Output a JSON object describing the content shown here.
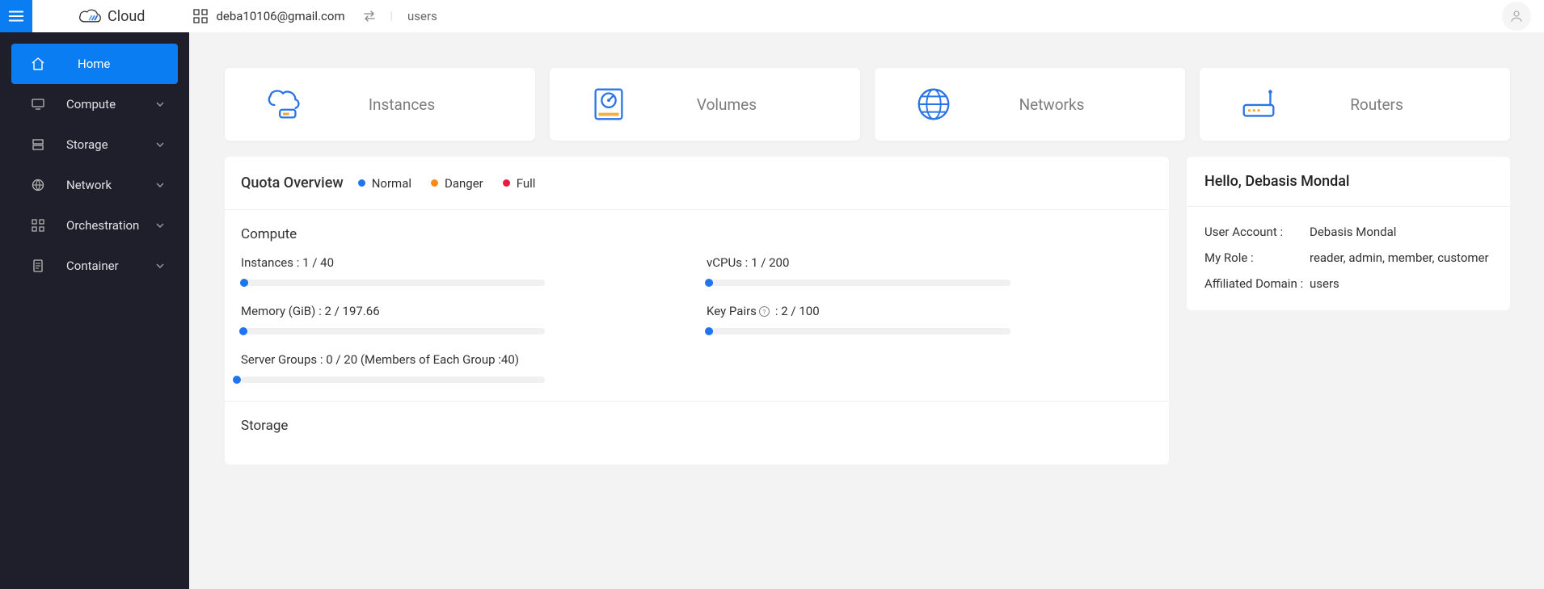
{
  "header": {
    "logo_text": "Cloud",
    "email": "deba10106@gmail.com",
    "domain": "users"
  },
  "sidebar": {
    "items": [
      {
        "label": "Home",
        "active": true,
        "icon": "home"
      },
      {
        "label": "Compute",
        "active": false,
        "icon": "compute",
        "expandable": true
      },
      {
        "label": "Storage",
        "active": false,
        "icon": "storage",
        "expandable": true
      },
      {
        "label": "Network",
        "active": false,
        "icon": "network",
        "expandable": true
      },
      {
        "label": "Orchestration",
        "active": false,
        "icon": "orchestration",
        "expandable": true
      },
      {
        "label": "Container",
        "active": false,
        "icon": "container",
        "expandable": true
      }
    ]
  },
  "navcards": [
    {
      "label": "Instances"
    },
    {
      "label": "Volumes"
    },
    {
      "label": "Networks"
    },
    {
      "label": "Routers"
    }
  ],
  "quota": {
    "title": "Quota Overview",
    "legend": {
      "normal": "Normal",
      "danger": "Danger",
      "full": "Full"
    },
    "sections": [
      {
        "title": "Compute",
        "items": [
          {
            "label": "Instances :",
            "used": 1,
            "total": 40,
            "display": "1 / 40"
          },
          {
            "label": "vCPUs :",
            "used": 1,
            "total": 200,
            "display": "1 / 200"
          },
          {
            "label": "Memory (GiB) :",
            "used": 2,
            "total": 197.66,
            "display": "2 / 197.66"
          },
          {
            "label": "Key Pairs",
            "help": true,
            "used": 2,
            "total": 100,
            "display_suffix": ": 2 / 100"
          },
          {
            "label": "Server Groups :",
            "used": 0,
            "total": 20,
            "display": "0 / 20 (Members of Each Group :40)"
          }
        ]
      },
      {
        "title": "Storage",
        "items": []
      }
    ]
  },
  "user": {
    "hello_prefix": "Hello, ",
    "hello_name": "Debasis Mondal",
    "rows": [
      {
        "k": "User Account :",
        "v": "Debasis Mondal"
      },
      {
        "k": "My Role :",
        "v": "reader, admin, member, customer"
      },
      {
        "k": "Affiliated Domain :",
        "v": "users"
      }
    ]
  }
}
